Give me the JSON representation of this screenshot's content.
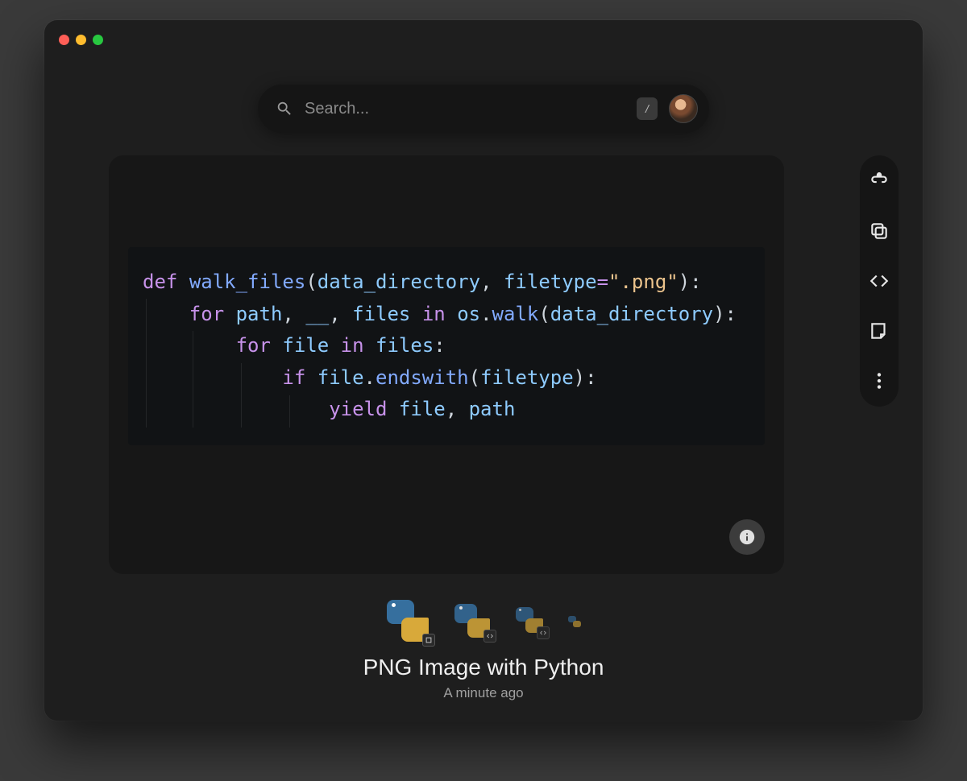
{
  "search": {
    "placeholder": "Search...",
    "value": "",
    "slash_key": "/"
  },
  "code": {
    "line1_def": "def",
    "line1_fn": "walk_files",
    "line1_p1_open": "(",
    "line1_arg1": "data_directory",
    "line1_comma": ",",
    "line1_arg2": "filetype",
    "line1_eq": "=",
    "line1_str": "\".png\"",
    "line1_close": "):",
    "line2_for": "for",
    "line2_path": "path",
    "line2_c1": ",",
    "line2_us": "__",
    "line2_c2": ",",
    "line2_files": "files",
    "line2_in": "in",
    "line2_os": "os",
    "line2_dot": ".",
    "line2_walk": "walk",
    "line2_open": "(",
    "line2_arg": "data_directory",
    "line2_close": "):",
    "line3_for": "for",
    "line3_file": "file",
    "line3_in": "in",
    "line3_files": "files",
    "line3_colon": ":",
    "line4_if": "if",
    "line4_file": "file",
    "line4_dot": ".",
    "line4_ends": "endswith",
    "line4_open": "(",
    "line4_arg": "filetype",
    "line4_close": "):",
    "line5_yield": "yield",
    "line5_file": "file",
    "line5_comma": ",",
    "line5_path": "path"
  },
  "snippet": {
    "title": "PNG Image with Python",
    "timestamp": "A minute ago"
  },
  "toolbar": {
    "share": "share-icon",
    "copy": "copy-icon",
    "code": "code-icon",
    "note": "note-icon",
    "more": "more-icon"
  },
  "thumbnails": [
    {
      "type": "python",
      "badge": "crop"
    },
    {
      "type": "python",
      "badge": "code"
    },
    {
      "type": "python",
      "badge": "code"
    },
    {
      "type": "python",
      "badge": ""
    }
  ]
}
